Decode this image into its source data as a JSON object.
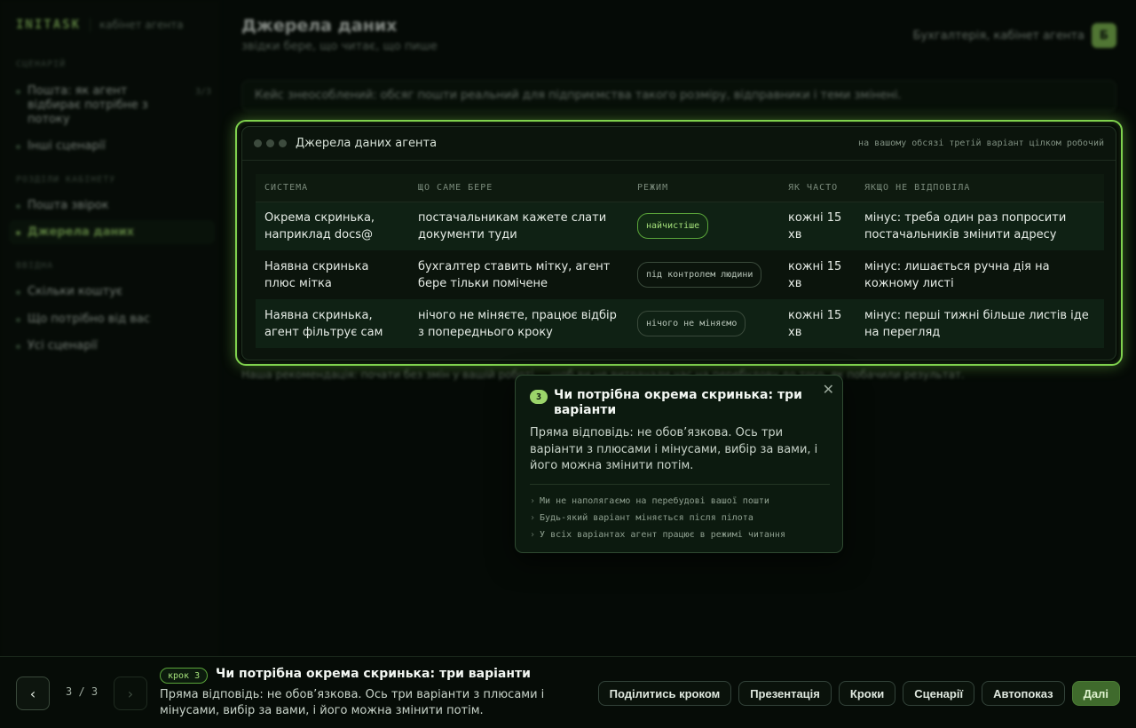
{
  "brand": {
    "name": "INITASK",
    "subtitle": "кабінет агента"
  },
  "sidebar": {
    "sections": [
      {
        "title": "СЦЕНАРІЙ"
      },
      {
        "title": "РОЗДІЛИ КАБІНЕТУ"
      },
      {
        "title": "ВВІДНА"
      }
    ],
    "items": [
      {
        "label": "Пошта: як агент відбирає потрібне з потоку",
        "count": "3/3"
      },
      {
        "label": "Інші сценарії"
      },
      {
        "label": "Пошта звірок"
      },
      {
        "label": "Джерела даних"
      },
      {
        "label": "Скільки коштує"
      },
      {
        "label": "Що потрібно від вас"
      },
      {
        "label": "Усі сценарії"
      }
    ]
  },
  "header": {
    "title": "Джерела даних",
    "subtitle": "звідки бере, що читає, що пише",
    "account": "Бухгалтерія, кабінет агента",
    "avatar": "Б"
  },
  "notice": "Кейс знеособлений: обсяг пошти реальний для підприємства такого розміру, відправники і теми змінені.",
  "footnote": "Наша рекомендація: почати без змін у вашій роботі ... щоб ви не витрачали час на перебудову до того, як побачили результат.",
  "card": {
    "title": "Джерела даних агента",
    "note": "на вашому обсязі третій варіант цілком робочий",
    "columns": [
      "СИСТЕМА",
      "ЩО САМЕ БЕРЕ",
      "РЕЖИМ",
      "ЯК ЧАСТО",
      "ЯКЩО НЕ ВІДПОВІЛА"
    ],
    "rows": [
      {
        "system": "Окрема скринька, наприклад docs@",
        "takes": "постачальникам кажете слати документи туди",
        "mode": "найчистіше",
        "freq": "кожні 15 хв",
        "fallback": "мінус: треба один раз попросити постачальників змінити адресу"
      },
      {
        "system": "Наявна скринька плюс мітка",
        "takes": "бухгалтер ставить мітку, агент бере тільки помічене",
        "mode": "під контролем людини",
        "freq": "кожні 15 хв",
        "fallback": "мінус: лишається ручна дія на кожному листі"
      },
      {
        "system": "Наявна скринька, агент фільтрує сам",
        "takes": "нічого не міняєте, працює відбір з попереднього кроку",
        "mode": "нічого не міняємо",
        "freq": "кожні 15 хв",
        "fallback": "мінус: перші тижні більше листів іде на перегляд"
      }
    ]
  },
  "popover": {
    "number": "3",
    "title": "Чи потрібна окрема скринька: три варіанти",
    "text": "Пряма відповідь: не обов’язкова. Ось три варіанти з плюсами і мінусами, вибір за вами, і його можна змінити потім.",
    "points": [
      "Ми не наполягаємо на перебудові вашої пошти",
      "Будь-який варіант міняється після пілота",
      "У всіх варіантах агент працює в режимі читання"
    ],
    "close": "✕"
  },
  "bottom": {
    "prev": "‹",
    "next": "›",
    "counter": "3 / 3",
    "badge": "крок 3",
    "title": "Чи потрібна окрема скринька: три варіанти",
    "text": "Пряма відповідь: не обов’язкова. Ось три варіанти з плюсами і мінусами, вибір за вами, і його можна змінити потім.",
    "actions": [
      "Поділитись кроком",
      "Презентація",
      "Кроки",
      "Сценарії",
      "Автопоказ"
    ],
    "primary": "Далі"
  },
  "colors": {
    "accent": "#7fd14d",
    "background": "#050a06",
    "panel": "#0b140c"
  }
}
